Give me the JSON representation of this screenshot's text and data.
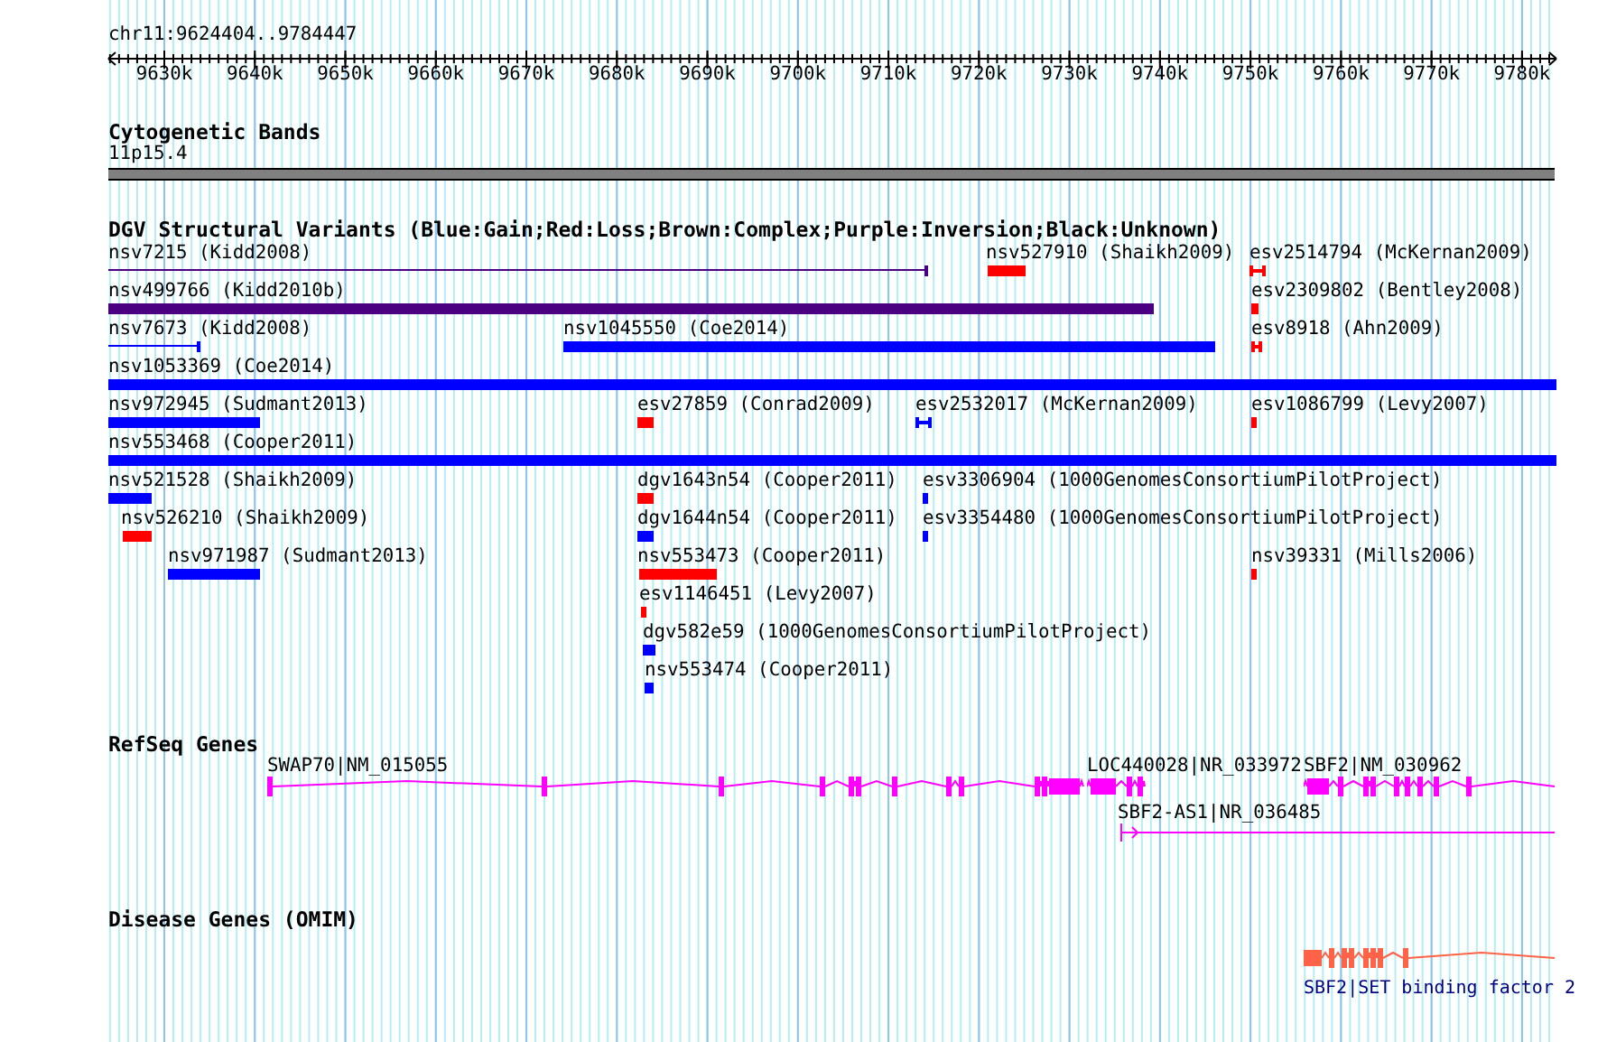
{
  "ruler": {
    "label": "chr11:9624404..9784447",
    "ticks": [
      "9630k",
      "9640k",
      "9650k",
      "9660k",
      "9670k",
      "9680k",
      "9690k",
      "9700k",
      "9710k",
      "9720k",
      "9730k",
      "9740k",
      "9750k",
      "9760k",
      "9770k",
      "9780k"
    ]
  },
  "cytogenetic_bands": {
    "title": "Cytogenetic Bands",
    "band_label": "11p15.4"
  },
  "dgv_variants": {
    "title": "DGV Structural Variants (Blue:Gain;Red:Loss;Brown:Complex;Purple:Inversion;Black:Unknown)",
    "features": [
      {
        "label": "nsv7215 (Kidd2008)",
        "kind": "inversion"
      },
      {
        "label": "nsv527910 (Shaikh2009)",
        "kind": "loss"
      },
      {
        "label": "esv2514794 (McKernan2009)",
        "kind": "loss"
      },
      {
        "label": "nsv499766 (Kidd2010b)",
        "kind": "inversion"
      },
      {
        "label": "esv2309802 (Bentley2008)",
        "kind": "loss"
      },
      {
        "label": "nsv7673 (Kidd2008)",
        "kind": "gain"
      },
      {
        "label": "nsv1045550 (Coe2014)",
        "kind": "gain"
      },
      {
        "label": "esv8918 (Ahn2009)",
        "kind": "loss"
      },
      {
        "label": "nsv1053369 (Coe2014)",
        "kind": "gain"
      },
      {
        "label": "nsv972945 (Sudmant2013)",
        "kind": "gain"
      },
      {
        "label": "esv27859 (Conrad2009)",
        "kind": "loss"
      },
      {
        "label": "esv2532017 (McKernan2009)",
        "kind": "gain"
      },
      {
        "label": "esv1086799 (Levy2007)",
        "kind": "loss"
      },
      {
        "label": "nsv553468 (Cooper2011)",
        "kind": "gain"
      },
      {
        "label": "nsv521528 (Shaikh2009)",
        "kind": "gain"
      },
      {
        "label": "dgv1643n54 (Cooper2011)",
        "kind": "loss"
      },
      {
        "label": "esv3306904 (1000GenomesConsortiumPilotProject)",
        "kind": "gain"
      },
      {
        "label": "nsv526210 (Shaikh2009)",
        "kind": "loss"
      },
      {
        "label": "dgv1644n54 (Cooper2011)",
        "kind": "gain"
      },
      {
        "label": "esv3354480 (1000GenomesConsortiumPilotProject)",
        "kind": "gain"
      },
      {
        "label": "nsv971987 (Sudmant2013)",
        "kind": "gain"
      },
      {
        "label": "nsv553473 (Cooper2011)",
        "kind": "loss"
      },
      {
        "label": "nsv39331 (Mills2006)",
        "kind": "loss"
      },
      {
        "label": "esv1146451 (Levy2007)",
        "kind": "loss"
      },
      {
        "label": "dgv582e59 (1000GenomesConsortiumPilotProject)",
        "kind": "gain"
      },
      {
        "label": "nsv553474 (Cooper2011)",
        "kind": "gain"
      }
    ]
  },
  "refseq_genes": {
    "title": "RefSeq Genes",
    "genes": [
      {
        "label": "SWAP70|NM_015055"
      },
      {
        "label": "LOC440028|NR_033972"
      },
      {
        "label": "SBF2|NM_030962"
      },
      {
        "label": "SBF2-AS1|NR_036485"
      }
    ]
  },
  "disease_genes": {
    "title": "Disease Genes (OMIM)",
    "genes": [
      {
        "label": "SBF2|SET binding factor 2"
      }
    ]
  }
}
